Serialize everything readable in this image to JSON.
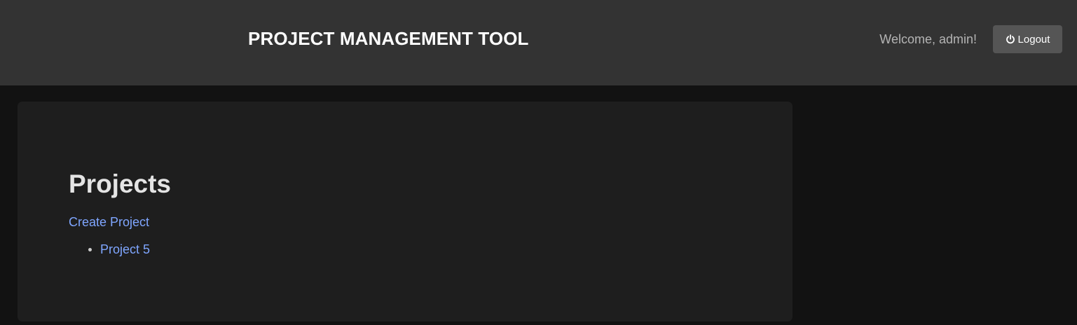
{
  "header": {
    "title": "PROJECT MANAGEMENT TOOL",
    "welcome_text": "Welcome, admin!",
    "logout_label": "Logout",
    "logout_icon": "power-icon"
  },
  "main": {
    "heading": "Projects",
    "create_link": "Create Project",
    "projects": [
      {
        "name": "Project 5"
      }
    ]
  },
  "colors": {
    "header_bg": "#333333",
    "page_bg": "#121212",
    "card_bg": "#1e1e1e",
    "link": "#7fa6ff",
    "button_bg": "#555555"
  }
}
